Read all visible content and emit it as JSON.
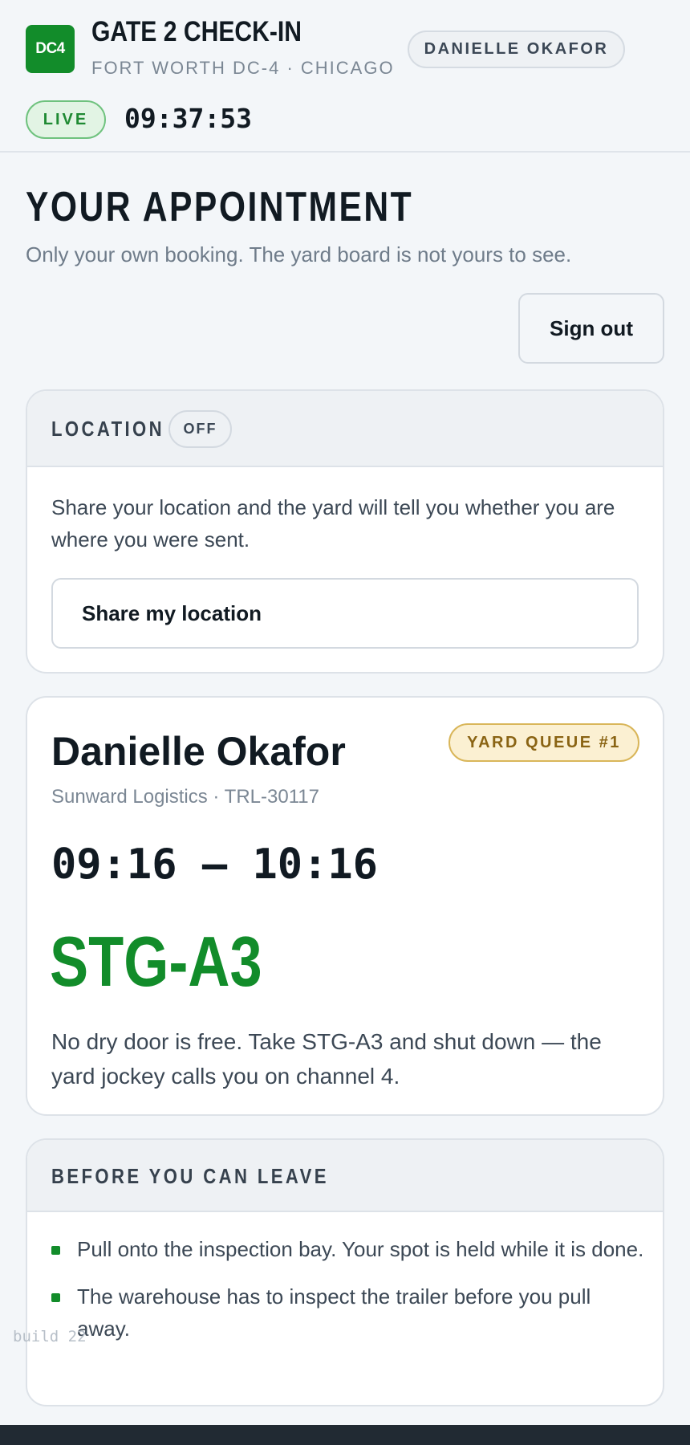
{
  "header": {
    "logo_text": "DC4",
    "title": "GATE 2 CHECK-IN",
    "subtitle": "FORT WORTH DC-4 · CHICAGO",
    "user_name": "DANIELLE OKAFOR",
    "live_label": "LIVE",
    "clock": "09:37:53"
  },
  "page": {
    "title": "YOUR APPOINTMENT",
    "subtitle": "Only your own booking. The yard board is not yours to see.",
    "sign_out_label": "Sign out"
  },
  "location": {
    "title": "LOCATION",
    "status": "OFF",
    "description": "Share your location and the yard will tell you whether you are where you were sent.",
    "share_button_label": "Share my location"
  },
  "appointment": {
    "driver_name": "Danielle Okafor",
    "queue_badge": "YARD QUEUE #1",
    "carrier_line": "Sunward Logistics · TRL-30117",
    "time_window": "09:16 – 10:16",
    "assignment": "STG-A3",
    "instruction": "No dry door is free. Take STG-A3 and shut down — the yard jockey calls you on channel 4."
  },
  "checklist": {
    "title": "BEFORE YOU CAN LEAVE",
    "items": [
      "Pull onto the inspection bay. Your spot is held while it is done.",
      "The warehouse has to inspect the trailer before you pull away."
    ]
  },
  "build_label": "build 22",
  "colors": {
    "accent_green": "#128c2a",
    "queue_badge_bg": "#fbf0d2",
    "queue_badge_text": "#8a6414",
    "background": "#f3f6f9"
  }
}
